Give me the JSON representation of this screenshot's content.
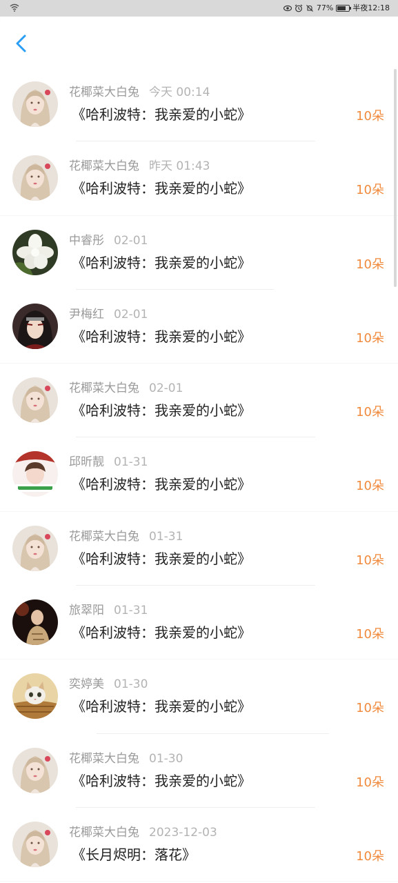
{
  "status_bar": {
    "battery": "77%",
    "time": "半夜12:18",
    "battery_level": 0.77,
    "icons": [
      "wifi-icon",
      "eye-icon",
      "alarm-icon",
      "mute-icon",
      "battery-icon"
    ]
  },
  "header": {
    "back_icon": "chevron-left-icon",
    "accent_color": "#2a9df4"
  },
  "colors": {
    "amount": "#f08a3c",
    "name": "#9a9a9a",
    "time": "#b3b3b3",
    "title": "#222222"
  },
  "items": [
    {
      "name": "花椰菜大白兔",
      "time": "今天 00:14",
      "title": "《哈利波特：我亲爱的小蛇》",
      "amount": "10朵",
      "avatar": "girl-avatar"
    },
    {
      "name": "花椰菜大白兔",
      "time": "昨天 01:43",
      "title": "《哈利波特：我亲爱的小蛇》",
      "amount": "10朵",
      "avatar": "girl-avatar"
    },
    {
      "name": "中睿彤",
      "time": "02-01",
      "title": "《哈利波特：我亲爱的小蛇》",
      "amount": "10朵",
      "avatar": "flower-avatar"
    },
    {
      "name": "尹梅红",
      "time": "02-01",
      "title": "《哈利波特：我亲爱的小蛇》",
      "amount": "10朵",
      "avatar": "anime-avatar"
    },
    {
      "name": "花椰菜大白兔",
      "time": "02-01",
      "title": "《哈利波特：我亲爱的小蛇》",
      "amount": "10朵",
      "avatar": "girl-avatar"
    },
    {
      "name": "邱昕靓",
      "time": "01-31",
      "title": "《哈利波特：我亲爱的小蛇》",
      "amount": "10朵",
      "avatar": "sticker-avatar"
    },
    {
      "name": "花椰菜大白兔",
      "time": "01-31",
      "title": "《哈利波特：我亲爱的小蛇》",
      "amount": "10朵",
      "avatar": "girl-avatar"
    },
    {
      "name": "旅翠阳",
      "time": "01-31",
      "title": "《哈利波特：我亲爱的小蛇》",
      "amount": "10朵",
      "avatar": "portrait-avatar"
    },
    {
      "name": "奕婷美",
      "time": "01-30",
      "title": "《哈利波特：我亲爱的小蛇》",
      "amount": "10朵",
      "avatar": "cat-avatar"
    },
    {
      "name": "花椰菜大白兔",
      "time": "01-30",
      "title": "《哈利波特：我亲爱的小蛇》",
      "amount": "10朵",
      "avatar": "girl-avatar"
    },
    {
      "name": "花椰菜大白兔",
      "time": "2023-12-03",
      "title": "《长月烬明：落花》",
      "amount": "10朵",
      "avatar": "girl-avatar"
    }
  ]
}
